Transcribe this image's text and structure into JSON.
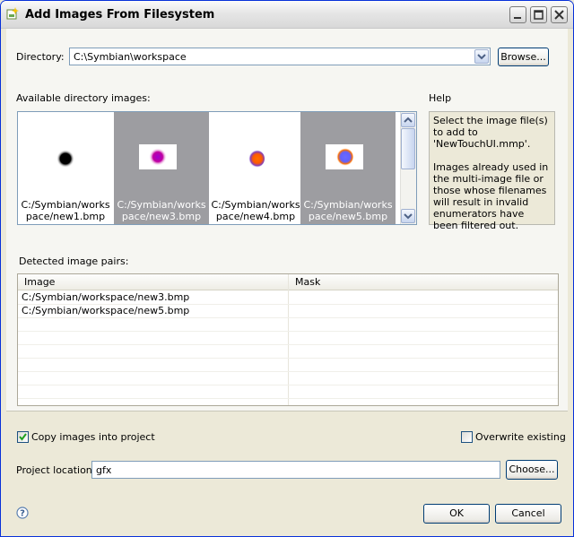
{
  "window": {
    "title": "Add Images From Filesystem"
  },
  "directory": {
    "label": "Directory:",
    "value": "C:\\Symbian\\workspace",
    "browse_label": "Browse..."
  },
  "available": {
    "label": "Available directory images:",
    "images": [
      {
        "path_line1": "C:/Symbian/works",
        "path_line2": "pace/new1.bmp",
        "selected": false,
        "swatch": "black"
      },
      {
        "path_line1": "C:/Symbian/works",
        "path_line2": "pace/new3.bmp",
        "selected": true,
        "swatch": "#b000c0"
      },
      {
        "path_line1": "C:/Symbian/works",
        "path_line2": "pace/new4.bmp",
        "selected": false,
        "swatch": "#ff6a00"
      },
      {
        "path_line1": "C:/Symbian/works",
        "path_line2": "pace/new5.bmp",
        "selected": true,
        "swatch": "#6060ff"
      }
    ]
  },
  "help": {
    "label": "Help",
    "para1": "Select the image file(s) to add to 'NewTouchUI.mmp'.",
    "para2": "Images already used in the multi-image file or those whose filenames will result in invalid enumerators have been filtered out."
  },
  "pairs": {
    "label": "Detected image pairs:",
    "columns": [
      "Image",
      "Mask"
    ],
    "rows": [
      {
        "image": "C:/Symbian/workspace/new3.bmp",
        "mask": ""
      },
      {
        "image": "C:/Symbian/workspace/new5.bmp",
        "mask": ""
      }
    ]
  },
  "options": {
    "copy_label": "Copy images into project",
    "copy_checked": true,
    "overwrite_label": "Overwrite existing",
    "overwrite_checked": false
  },
  "project_location": {
    "label": "Project location:",
    "value": "gfx",
    "choose_label": "Choose..."
  },
  "footer": {
    "ok_label": "OK",
    "cancel_label": "Cancel"
  },
  "colors": {
    "accent": "#003c74",
    "selection": "#9d9da1",
    "field_border": "#7f9db9"
  }
}
